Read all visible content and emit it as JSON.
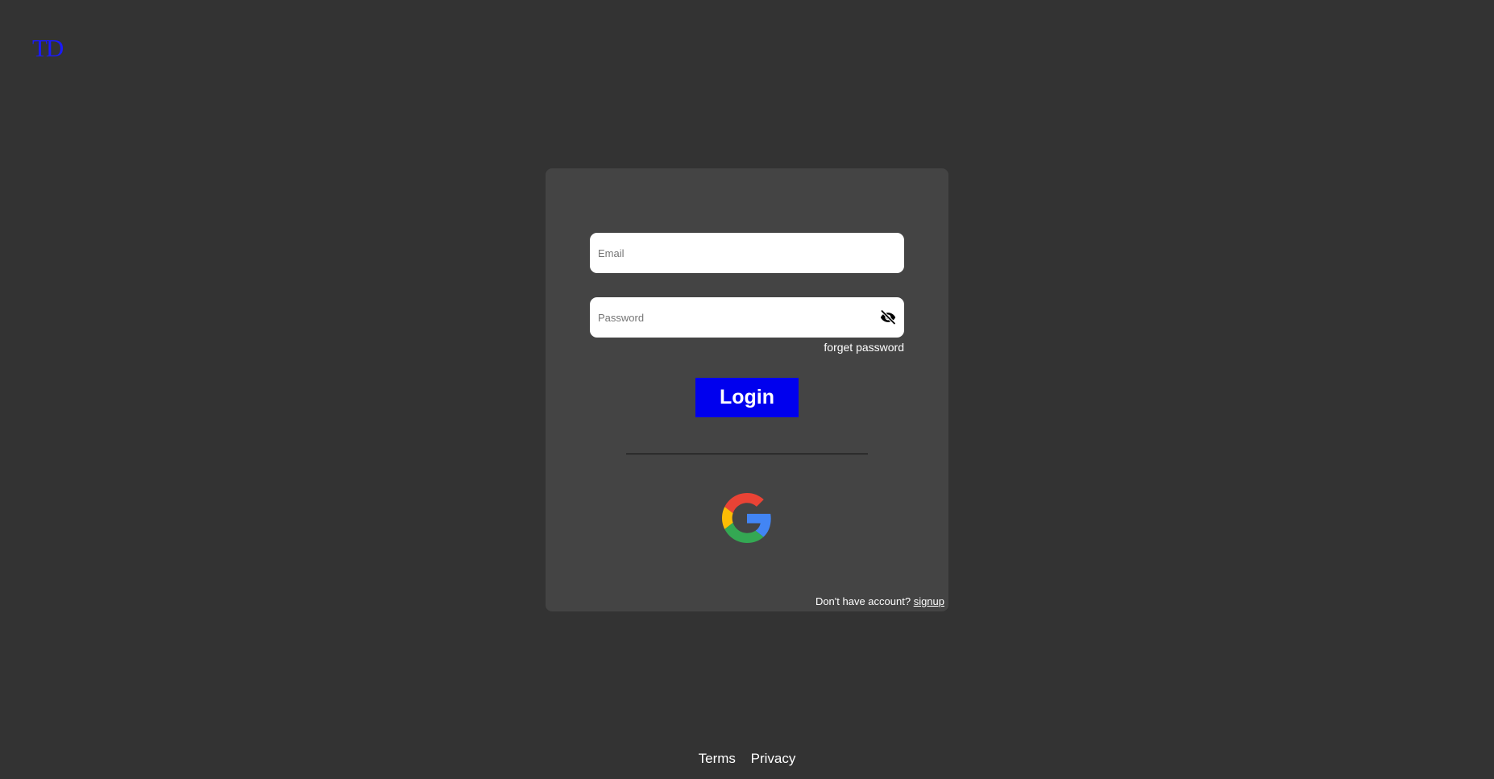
{
  "logo": {
    "text": "TD"
  },
  "login_form": {
    "email": {
      "placeholder": "Email",
      "value": ""
    },
    "password": {
      "placeholder": "Password",
      "value": "",
      "toggle_icon": "eye-off-icon"
    },
    "forget_password_label": "forget password",
    "login_label": "Login",
    "social": {
      "icon": "google-icon"
    },
    "signup_prompt": "Don't have account?",
    "signup_label": "signup"
  },
  "footer": {
    "links": [
      "Terms",
      "Privacy"
    ]
  },
  "colors": {
    "background": "#333333",
    "card": "#444444",
    "accent": "#0000ee",
    "logo": "#1a1aff"
  }
}
